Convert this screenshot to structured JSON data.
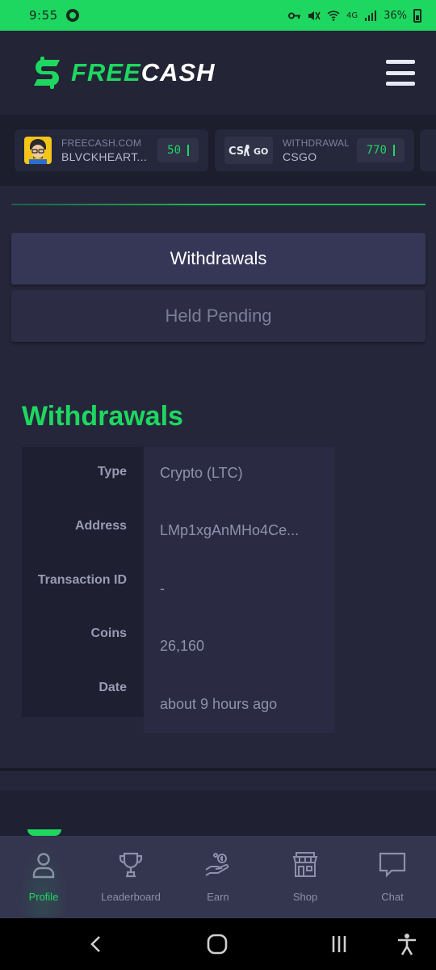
{
  "status_bar": {
    "time": "9:55",
    "network": "4G",
    "battery": "36%"
  },
  "header": {
    "logo_free": "FREE",
    "logo_cash": "CASH",
    "menu_icon": "hamburger-icon"
  },
  "ticker": [
    {
      "source": "FREECASH.COM",
      "user": "BLVCKHEART...",
      "amount": "50",
      "thumb": "avatar-icon"
    },
    {
      "source": "WITHDRAWAL",
      "user": "CSGO",
      "amount": "770",
      "thumb": "csgo-logo"
    }
  ],
  "tabs": {
    "withdrawals": "Withdrawals",
    "held_pending": "Held Pending"
  },
  "section_title": "Withdrawals",
  "withdrawal": {
    "labels": {
      "type": "Type",
      "address": "Address",
      "transaction_id": "Transaction ID",
      "coins": "Coins",
      "date": "Date"
    },
    "values": {
      "type": "Crypto (LTC)",
      "address": "LMp1xgAnMHo4Ce...",
      "transaction_id": "-",
      "coins": "26,160",
      "date": "about 9 hours ago"
    }
  },
  "bottom_nav": [
    {
      "label": "Profile",
      "icon": "profile-icon",
      "active": true
    },
    {
      "label": "Leaderboard",
      "icon": "trophy-icon",
      "active": false
    },
    {
      "label": "Earn",
      "icon": "earn-icon",
      "active": false
    },
    {
      "label": "Shop",
      "icon": "shop-icon",
      "active": false
    },
    {
      "label": "Chat",
      "icon": "chat-icon",
      "active": false
    }
  ],
  "colors": {
    "brand_green": "#1ed760",
    "background": "#25263a",
    "nav_background": "#34354f"
  }
}
